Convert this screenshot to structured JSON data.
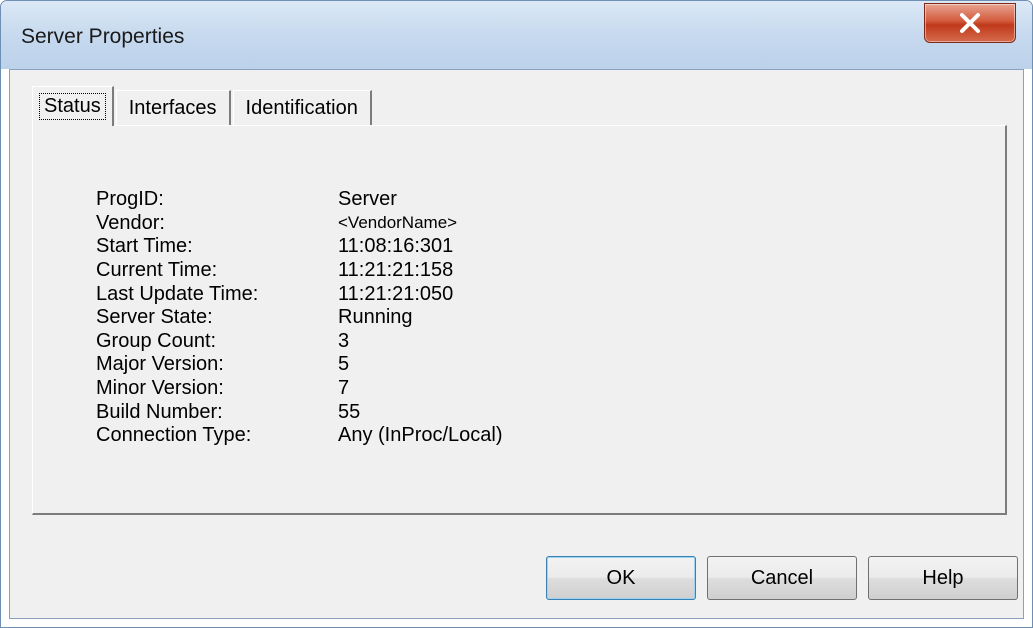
{
  "window": {
    "title": "Server Properties",
    "close_label": "X"
  },
  "tabs": [
    {
      "label": "Status",
      "active": true
    },
    {
      "label": "Interfaces",
      "active": false
    },
    {
      "label": "Identification",
      "active": false
    }
  ],
  "status": {
    "rows": [
      {
        "label": "ProgID:",
        "value": "Server"
      },
      {
        "label": "Vendor:",
        "value": "<VendorName>"
      },
      {
        "label": "Start Time:",
        "value": "11:08:16:301"
      },
      {
        "label": "Current Time:",
        "value": "11:21:21:158"
      },
      {
        "label": "Last Update Time:",
        "value": "11:21:21:050"
      },
      {
        "label": "Server State:",
        "value": "Running"
      },
      {
        "label": "Group Count:",
        "value": "3"
      },
      {
        "label": "Major Version:",
        "value": "5"
      },
      {
        "label": "Minor Version:",
        "value": "7"
      },
      {
        "label": "Build Number:",
        "value": "55"
      },
      {
        "label": "Connection Type:",
        "value": "Any (InProc/Local)"
      }
    ]
  },
  "buttons": {
    "ok": "OK",
    "cancel": "Cancel",
    "help": "Help"
  }
}
